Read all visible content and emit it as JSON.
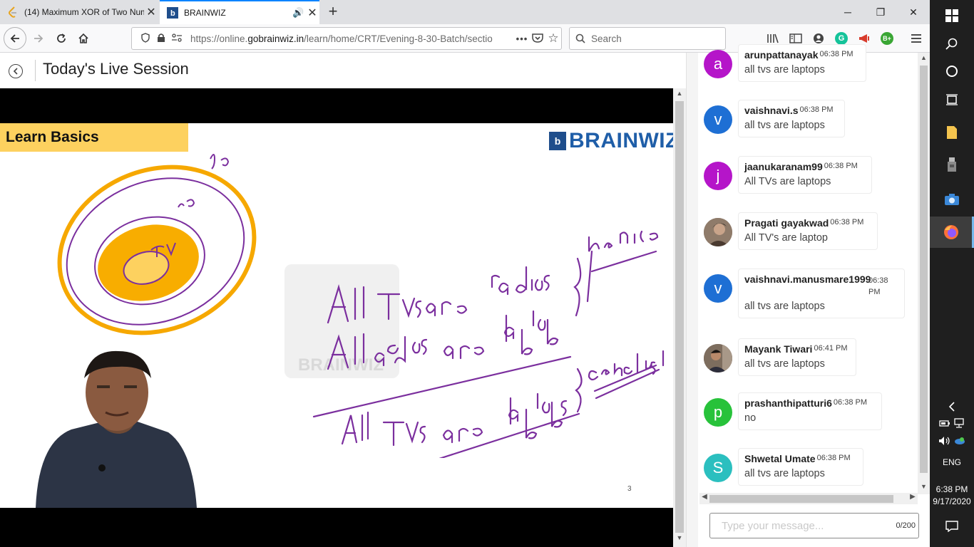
{
  "browser": {
    "tabs": [
      {
        "title": "(14) Maximum XOR of Two Num",
        "active": false
      },
      {
        "title": "BRAINWIZ",
        "active": true
      }
    ],
    "url_prefix": "https://online.",
    "url_domain": "gobrainwiz.in",
    "url_rest": "/learn/home/CRT/Evening-8-30-Batch/sectio",
    "search_placeholder": "Search",
    "ext_badge": "B+",
    "ext_g": "G"
  },
  "page": {
    "title": "Today's Live Session"
  },
  "slide": {
    "banner": "Learn Basics",
    "brand_name": "BRAINWIZ",
    "brand_letter": "b",
    "watermark": "BRAINWIZ",
    "slide_number": "3"
  },
  "chat": {
    "messages": [
      {
        "avatar_letter": "a",
        "avatar_color": "#b515c9",
        "name": "arunpattanayak",
        "time": "06:38 PM",
        "text": "all tvs are laptops"
      },
      {
        "avatar_letter": "v",
        "avatar_color": "#1e6fd4",
        "name": "vaishnavi.s",
        "time": "06:38 PM",
        "text": "all tvs are laptops"
      },
      {
        "avatar_letter": "j",
        "avatar_color": "#b515c9",
        "name": "jaanukaranam99",
        "time": "06:38 PM",
        "text": "All TVs are laptops"
      },
      {
        "avatar_letter": "",
        "avatar_color": "#6b5a4c",
        "name": "Pragati gayakwad",
        "time": "06:38 PM",
        "text": "All TV's are laptop"
      },
      {
        "avatar_letter": "v",
        "avatar_color": "#1e6fd4",
        "name": "vaishnavi.manusmare1999",
        "time": "06:38 PM",
        "text": "all tvs are laptops"
      },
      {
        "avatar_letter": "",
        "avatar_color": "#5c4a3f",
        "name": "Mayank Tiwari",
        "time": "06:41 PM",
        "text": "all tvs are laptops"
      },
      {
        "avatar_letter": "p",
        "avatar_color": "#27c23a",
        "name": "prashanthipatturi6",
        "time": "06:38 PM",
        "text": "no"
      },
      {
        "avatar_letter": "S",
        "avatar_color": "#2bbfbf",
        "name": "Shwetal Umate",
        "time": "06:38 PM",
        "text": "all tvs are laptops"
      }
    ],
    "input_placeholder": "Type your message...",
    "counter": "0/200"
  },
  "taskbar": {
    "language": "ENG",
    "time": "6:38 PM",
    "date": "9/17/2020"
  }
}
